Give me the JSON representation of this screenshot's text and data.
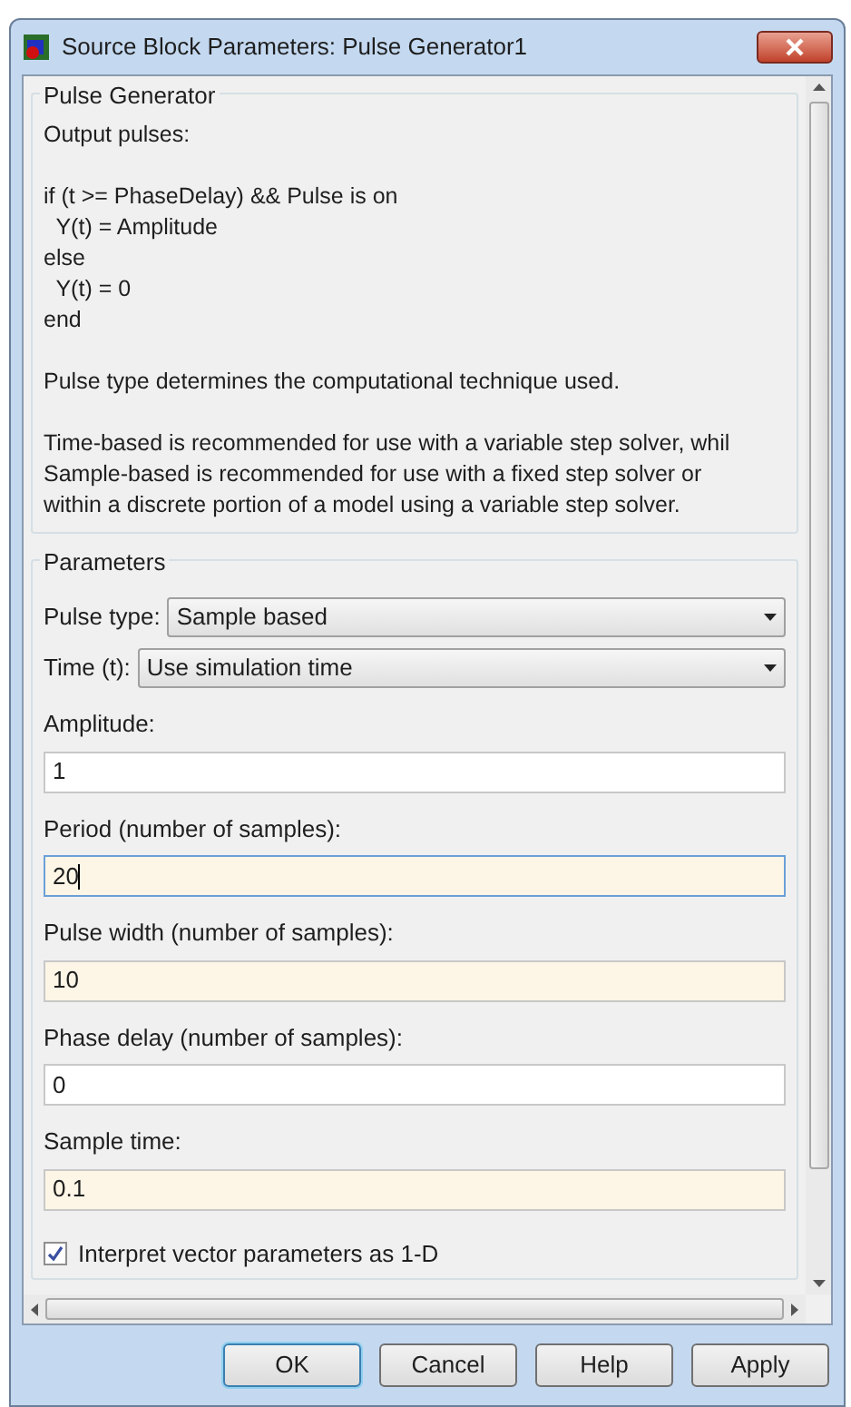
{
  "window": {
    "title": "Source Block Parameters: Pulse Generator1"
  },
  "description": {
    "title": "Pulse Generator",
    "paragraphs": [
      [
        "Output pulses:"
      ],
      [
        "if (t >= PhaseDelay) && Pulse is on",
        "  Y(t) = Amplitude",
        "else",
        "  Y(t) = 0",
        "end"
      ],
      [
        "Pulse type determines the computational technique used."
      ],
      [
        "Time-based is recommended for use with a variable step solver, whil",
        "Sample-based is recommended for use with a fixed step solver or",
        "within a discrete portion of a model using a variable step solver."
      ]
    ]
  },
  "parameters": {
    "title": "Parameters",
    "dropdowns": [
      {
        "label": "Pulse type:",
        "value": "Sample based"
      },
      {
        "label": "Time (t):",
        "value": "Use simulation time"
      }
    ],
    "fields": [
      {
        "label": "Amplitude:",
        "value": "1",
        "highlighted": false,
        "focused": false
      },
      {
        "label": "Period (number of samples):",
        "value": "20",
        "highlighted": true,
        "focused": true
      },
      {
        "label": "Pulse width (number of samples):",
        "value": "10",
        "highlighted": true,
        "focused": false
      },
      {
        "label": "Phase delay (number of samples):",
        "value": "0",
        "highlighted": false,
        "focused": false
      },
      {
        "label": "Sample time:",
        "value": "0.1",
        "highlighted": true,
        "focused": false
      }
    ],
    "checkbox": {
      "label": "Interpret vector parameters as 1-D",
      "checked": true
    }
  },
  "buttons": [
    {
      "label": "OK",
      "default": true
    },
    {
      "label": "Cancel",
      "default": false
    },
    {
      "label": "Help",
      "default": false
    },
    {
      "label": "Apply",
      "default": false
    }
  ]
}
